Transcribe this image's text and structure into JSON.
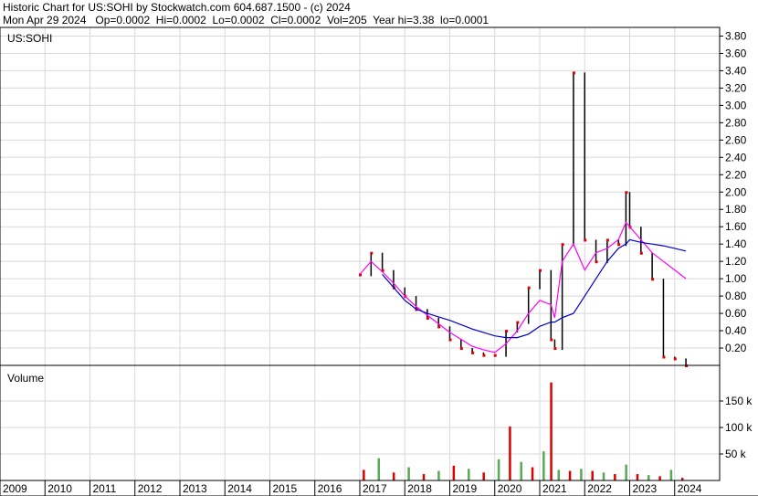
{
  "header": {
    "line1": "Historic Chart for US:SOHI by Stockwatch.com 604.687.1500 - (c) 2024",
    "line2": "Mon Apr 29 2024   Op=0.0002  Hi=0.0002  Lo=0.0002  Cl=0.0002  Vol=205  Year hi=3.38  lo=0.0001"
  },
  "colors": {
    "up": "#000000",
    "down": "#dd0000",
    "short_ma": "#ff00ff",
    "long_ma": "#0000cc",
    "grid": "#d8d8d8",
    "vol_up": "#55aa55",
    "vol_down": "#dd0000"
  },
  "chart_data": [
    {
      "type": "line",
      "title": "US:SOHI",
      "x": [
        "2017-01",
        "2017-04",
        "2017-07",
        "2017-10",
        "2018-01",
        "2018-04",
        "2018-07",
        "2018-10",
        "2019-01",
        "2019-04",
        "2019-07",
        "2019-10",
        "2020-01",
        "2020-04",
        "2020-07",
        "2020-10",
        "2021-01",
        "2021-04",
        "2021-05",
        "2021-07",
        "2021-10",
        "2022-01",
        "2022-04",
        "2022-07",
        "2022-10",
        "2022-12",
        "2023-01",
        "2023-04",
        "2023-07",
        "2023-10",
        "2024-01",
        "2024-04"
      ],
      "series": [
        {
          "values": [
            1.05,
            1.3,
            1.1,
            0.9,
            0.8,
            0.65,
            0.55,
            0.45,
            0.3,
            0.2,
            0.15,
            0.12,
            0.12,
            0.4,
            0.5,
            0.9,
            1.1,
            0.3,
            0.2,
            1.4,
            3.38,
            1.45,
            1.2,
            1.45,
            1.4,
            2.0,
            1.6,
            1.3,
            1.0,
            0.1,
            0.08,
            0.0002
          ]
        },
        {
          "values": [
            1.05,
            1.2,
            1.08,
            0.95,
            0.8,
            0.68,
            0.58,
            0.48,
            0.38,
            0.3,
            0.22,
            0.18,
            0.15,
            0.25,
            0.4,
            0.6,
            0.75,
            0.7,
            0.55,
            1.2,
            1.4,
            1.1,
            1.3,
            1.35,
            1.45,
            1.65,
            1.6,
            1.45,
            1.3,
            1.2,
            1.1,
            1.0
          ]
        },
        {
          "values": [
            null,
            null,
            1.05,
            0.9,
            0.75,
            0.65,
            0.6,
            0.56,
            0.52,
            0.47,
            0.42,
            0.38,
            0.34,
            0.32,
            0.32,
            0.36,
            0.45,
            0.5,
            0.5,
            0.55,
            0.6,
            0.8,
            1.0,
            1.2,
            1.35,
            1.4,
            1.45,
            1.42,
            1.4,
            1.38,
            1.35,
            1.32
          ]
        }
      ],
      "ylim": [
        0,
        3.9
      ],
      "ylabel_ticks": [
        "0.20",
        "0.40",
        "0.60",
        "0.80",
        "1.00",
        "1.20",
        "1.40",
        "1.60",
        "1.80",
        "2.00",
        "2.20",
        "2.40",
        "2.60",
        "2.80",
        "3.00",
        "3.20",
        "3.40",
        "3.60",
        "3.80"
      ]
    },
    {
      "type": "bar",
      "title": "Volume",
      "x": [
        "2017-02",
        "2017-06",
        "2017-10",
        "2018-02",
        "2018-06",
        "2018-10",
        "2019-02",
        "2019-06",
        "2019-10",
        "2020-02",
        "2020-05",
        "2020-08",
        "2020-11",
        "2021-02",
        "2021-04",
        "2021-06",
        "2021-09",
        "2021-12",
        "2022-03",
        "2022-06",
        "2022-09",
        "2022-12",
        "2023-03",
        "2023-06",
        "2023-09",
        "2023-12",
        "2024-03"
      ],
      "values": [
        20,
        42,
        15,
        25,
        12,
        18,
        28,
        22,
        15,
        40,
        102,
        35,
        25,
        55,
        185,
        20,
        18,
        22,
        18,
        15,
        12,
        30,
        12,
        10,
        8,
        20,
        5
      ],
      "ylim": [
        0,
        200
      ],
      "ylabel_ticks": [
        "50 k",
        "100 k",
        "150 k"
      ]
    }
  ],
  "x_axis_labels": [
    "2009",
    "2010",
    "2011",
    "2012",
    "2013",
    "2014",
    "2015",
    "2016",
    "2017",
    "2018",
    "2019",
    "2020",
    "2021",
    "2022",
    "2023",
    "2024"
  ]
}
